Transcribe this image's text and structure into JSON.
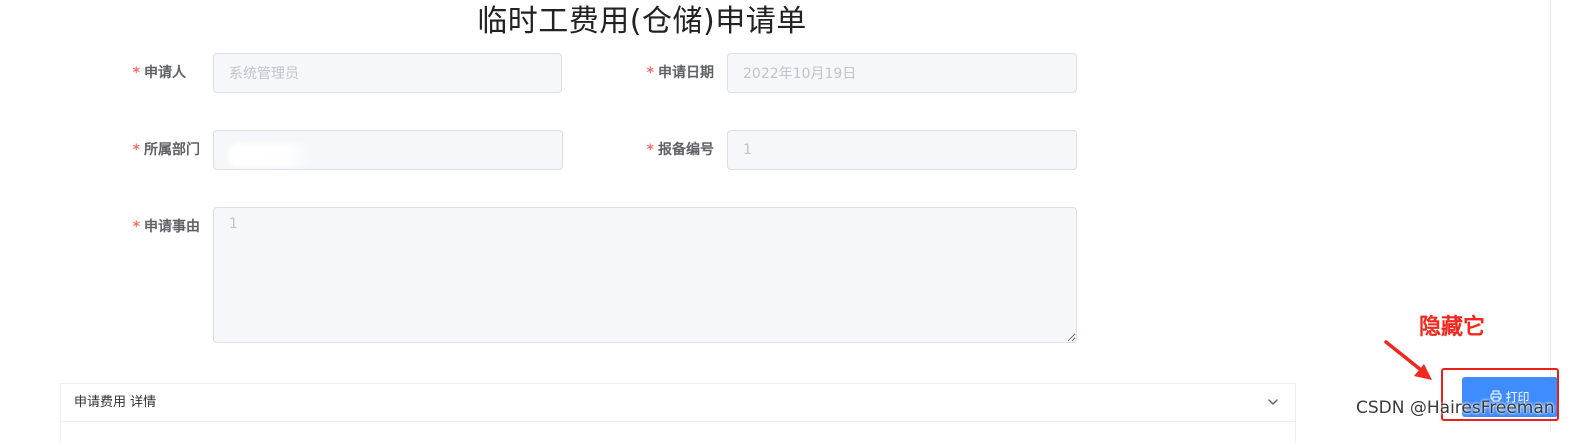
{
  "page_title": "临时工费用(仓储)申请单",
  "form": {
    "required_mark": "*",
    "applicant": {
      "label": "申请人",
      "value": "系统管理员"
    },
    "apply_date": {
      "label": "申请日期",
      "value": "2022年10月19日"
    },
    "department": {
      "label": "所属部门",
      "value": ""
    },
    "report_number": {
      "label": "报备编号",
      "value": "1"
    },
    "reason": {
      "label": "申请事由",
      "value": "1"
    }
  },
  "collapse": {
    "title": "申请费用 详情"
  },
  "print_button": {
    "label": "打印"
  },
  "annotation": {
    "text": "隐藏它",
    "color": "#f0281e"
  },
  "watermark": {
    "text": "CSDN @HairesFreeman"
  },
  "colors": {
    "primary": "#3f8cff",
    "required": "#f56c6c",
    "highlight": "#e8201a"
  },
  "icons": {
    "printer": "printer-icon",
    "chevron": "chevron-down-icon",
    "arrow": "arrow-annotation-icon"
  }
}
